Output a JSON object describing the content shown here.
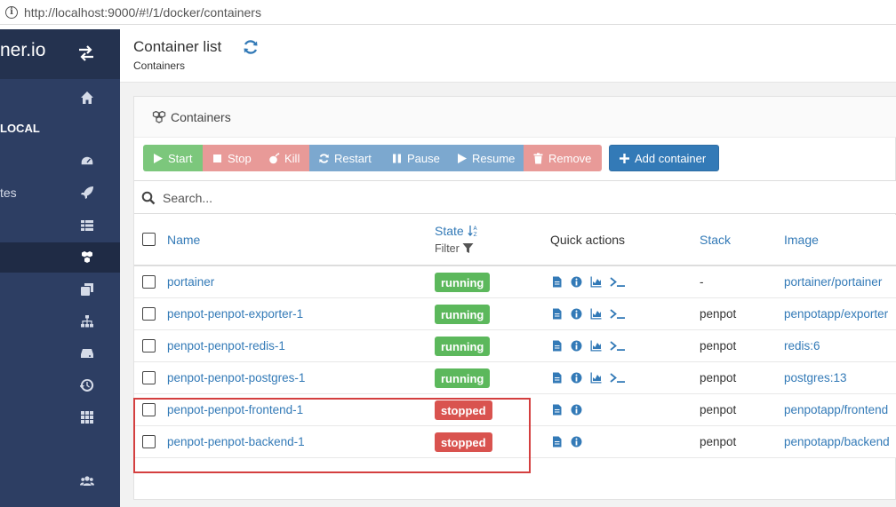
{
  "browser": {
    "url": "http://localhost:9000/#!/1/docker/containers"
  },
  "sidebar": {
    "brand": "ner.io",
    "section": "LOCAL",
    "partial_item": "tes",
    "icons": [
      "home-icon",
      "dashboard-icon",
      "rocket-icon",
      "list-icon",
      "cubes-icon",
      "clone-icon",
      "sitemap-icon",
      "hdd-icon",
      "history-icon",
      "grid-icon",
      "users-icon"
    ]
  },
  "header": {
    "title": "Container list",
    "breadcrumb": "Containers"
  },
  "panel": {
    "title": "Containers"
  },
  "actions": {
    "start": "Start",
    "stop": "Stop",
    "kill": "Kill",
    "restart": "Restart",
    "pause": "Pause",
    "resume": "Resume",
    "remove": "Remove",
    "add": "Add container"
  },
  "search": {
    "placeholder": "Search..."
  },
  "table": {
    "headers": {
      "name": "Name",
      "state": "State",
      "filter": "Filter",
      "quick_actions": "Quick actions",
      "stack": "Stack",
      "image": "Image"
    },
    "rows": [
      {
        "name": "portainer",
        "state": "running",
        "stack": "-",
        "image": "portainer/portainer"
      },
      {
        "name": "penpot-penpot-exporter-1",
        "state": "running",
        "stack": "penpot",
        "image": "penpotapp/exporter"
      },
      {
        "name": "penpot-penpot-redis-1",
        "state": "running",
        "stack": "penpot",
        "image": "redis:6"
      },
      {
        "name": "penpot-penpot-postgres-1",
        "state": "running",
        "stack": "penpot",
        "image": "postgres:13"
      },
      {
        "name": "penpot-penpot-frontend-1",
        "state": "stopped",
        "stack": "penpot",
        "image": "penpotapp/frontend"
      },
      {
        "name": "penpot-penpot-backend-1",
        "state": "stopped",
        "stack": "penpot",
        "image": "penpotapp/backend"
      }
    ]
  },
  "colors": {
    "sidebar": "#2d3e63",
    "running": "#5cb85c",
    "stopped": "#d9534f",
    "link": "#337ab7",
    "highlight": "#d43f3f"
  }
}
